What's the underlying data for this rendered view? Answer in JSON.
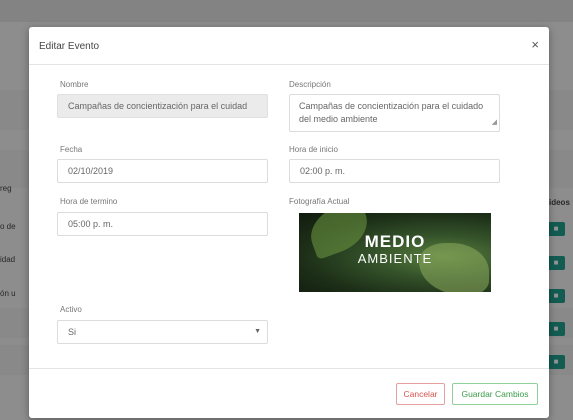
{
  "background": {
    "left_fragments": [
      "reg",
      "o de",
      "idad",
      "ón u"
    ],
    "right_header": "ideos",
    "button_icon": "video-camera-icon",
    "accent_color": "#1f9f8e"
  },
  "modal": {
    "title": "Editar Evento",
    "close_symbol": "×",
    "nombre": {
      "label": "Nombre",
      "value": "Campañas de concientización para el cuidad"
    },
    "descripcion": {
      "label": "Descripción",
      "value": "Campañas de concientización para el cuidado del medio ambiente"
    },
    "fecha": {
      "label": "Fecha",
      "value": "02/10/2019"
    },
    "hora_inicio": {
      "label": "Hora de inicio",
      "value": "02:00 p. m."
    },
    "hora_termino": {
      "label": "Hora de termino",
      "value": "05:00 p. m."
    },
    "fotografia": {
      "label": "Fotografía Actual",
      "line1": "MEDIO",
      "line2": "AMBIENTE"
    },
    "activo": {
      "label": "Activo",
      "value": "Si"
    },
    "cancel_label": "Cancelar",
    "save_label": "Guardar Cambios",
    "cancel_color": "#d9534f",
    "save_color": "#3a9b49"
  }
}
